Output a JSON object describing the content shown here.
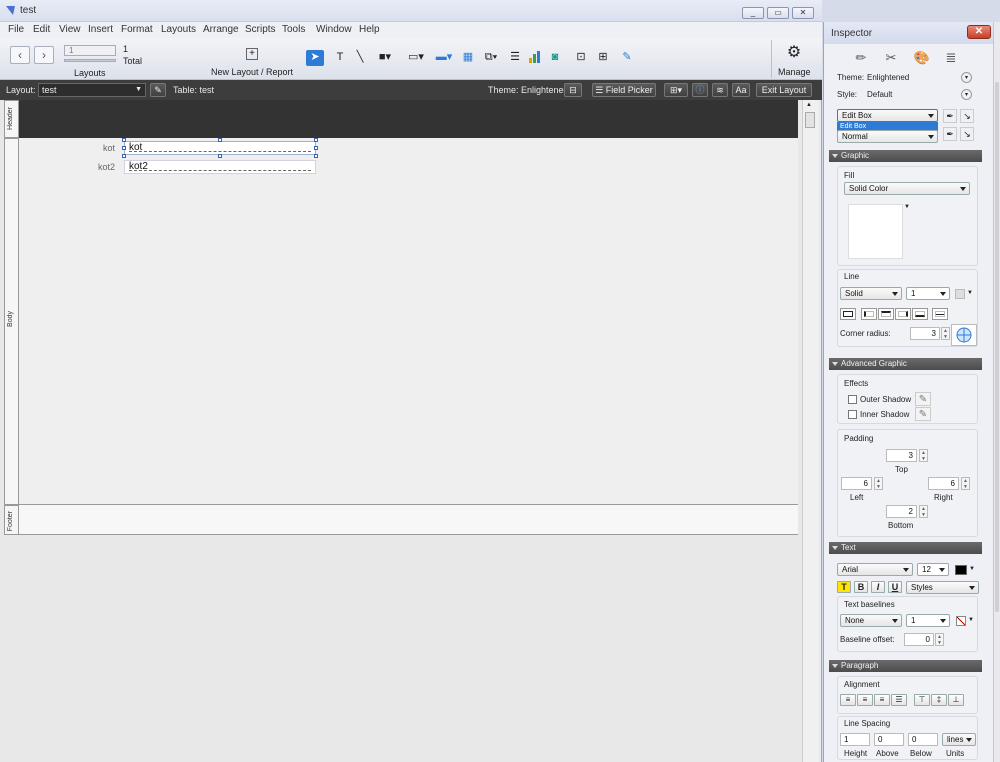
{
  "window": {
    "title": "test",
    "buttons": [
      "_",
      "□",
      "✕"
    ]
  },
  "menu": [
    "File",
    "Edit",
    "View",
    "Insert",
    "Format",
    "Layouts",
    "Arrange",
    "Scripts",
    "Tools",
    "Window",
    "Help"
  ],
  "toolbar": {
    "record_number": "1",
    "total_count": "1",
    "total_label": "Total",
    "layouts_label": "Layouts",
    "new_layout_label": "New Layout / Report",
    "manage_label": "Manage"
  },
  "layoutbar": {
    "layout_label": "Layout:",
    "layout_value": "test",
    "table_label": "Table: test",
    "theme_label": "Theme: Enlightened",
    "field_picker": "Field Picker",
    "exit_layout": "Exit Layout",
    "aa": "Aa"
  },
  "parts": {
    "header": "Header",
    "body": "Body",
    "footer": "Footer"
  },
  "fields": [
    {
      "label": "kot",
      "value": "kot"
    },
    {
      "label": "kot2",
      "value": "kot2"
    }
  ],
  "inspector": {
    "title": "Inspector",
    "theme_label": "Theme:",
    "theme_value": "Enlightened",
    "style_label": "Style:",
    "style_value": "Default",
    "object_select": "Edit Box",
    "object_dropdown_option": "Edit Box",
    "state_select": "Normal",
    "graphic": {
      "header": "Graphic",
      "fill_label": "Fill",
      "fill_value": "Solid Color",
      "line_label": "Line",
      "line_style": "Solid",
      "line_width": "1",
      "corner_label": "Corner radius:",
      "corner_value": "3"
    },
    "advanced": {
      "header": "Advanced Graphic",
      "effects_label": "Effects",
      "outer_shadow": "Outer Shadow",
      "inner_shadow": "Inner Shadow",
      "padding_label": "Padding",
      "top_value": "3",
      "top_label": "Top",
      "left_value": "6",
      "left_label": "Left",
      "right_value": "6",
      "right_label": "Right",
      "bottom_value": "2",
      "bottom_label": "Bottom"
    },
    "text": {
      "header": "Text",
      "font": "Arial",
      "size": "12",
      "styles_label": "Styles",
      "baselines_label": "Text baselines",
      "baseline_style": "None",
      "baseline_width": "1",
      "offset_label": "Baseline offset:",
      "offset_value": "0",
      "btn_t": "T",
      "btn_b": "B",
      "btn_i": "I",
      "btn_u": "U"
    },
    "paragraph": {
      "header": "Paragraph",
      "alignment_label": "Alignment",
      "spacing_label": "Line Spacing",
      "height_value": "1",
      "height_label": "Height",
      "above_value": "0",
      "above_label": "Above",
      "below_value": "0",
      "below_label": "Below",
      "units_value": "lines",
      "units_label": "Units"
    }
  },
  "colors": {
    "header_part": "#333333",
    "accent_select": "#2e7bd6",
    "text_swatch": "#000000"
  }
}
